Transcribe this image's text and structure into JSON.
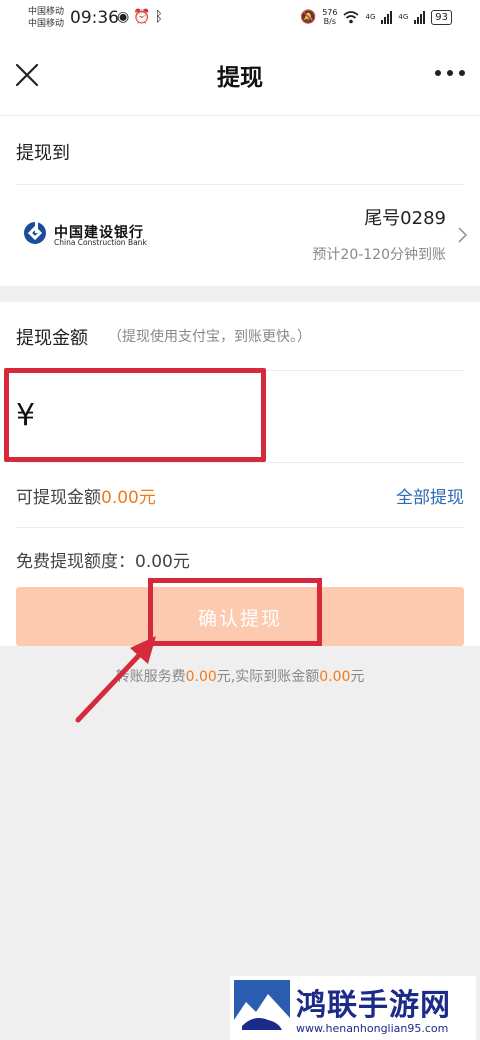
{
  "status_bar": {
    "carrier_1": "中国移动",
    "carrier_2": "中国移动",
    "time": "09:36",
    "speed_value": "576",
    "speed_unit": "B/s",
    "network_1": "4G",
    "network_2": "4G",
    "battery": "93",
    "left_icons": [
      "eye-icon",
      "alarm-icon",
      "bluetooth-icon"
    ],
    "right_icons": [
      "mute-icon",
      "wifi-icon",
      "signal-icon",
      "signal-icon",
      "battery-icon"
    ]
  },
  "nav": {
    "title": "提现",
    "left_icon": "close-icon",
    "right_icon": "more-icon"
  },
  "withdraw_to": {
    "label": "提现到",
    "bank": {
      "name": "中国建设银行",
      "name_en": "China Construction Bank",
      "tail": "尾号0289",
      "eta": "预计20-120分钟到账"
    }
  },
  "amount": {
    "label": "提现金额",
    "hint": "（提现使用支付宝，到账更快。）",
    "currency_symbol": "¥",
    "input_value": "",
    "available_label": "可提现金额",
    "available_value": "0.00元",
    "withdraw_all": "全部提现",
    "free_quota": "免费提现额度：0.00元",
    "confirm_button": "确认提现"
  },
  "fee_note": {
    "prefix": "转账服务费",
    "fee_value": "0.00",
    "middle": "元,实际到账金额",
    "actual_value": "0.00",
    "suffix": "元"
  },
  "watermark": {
    "title": "鸿联手游网",
    "url": "www.henanhonglian95.com"
  },
  "colors": {
    "accent_orange": "#f07b1d",
    "link_blue": "#2b6ab4",
    "button_disabled": "#fdcab0",
    "highlight_red": "#d42a3c"
  }
}
